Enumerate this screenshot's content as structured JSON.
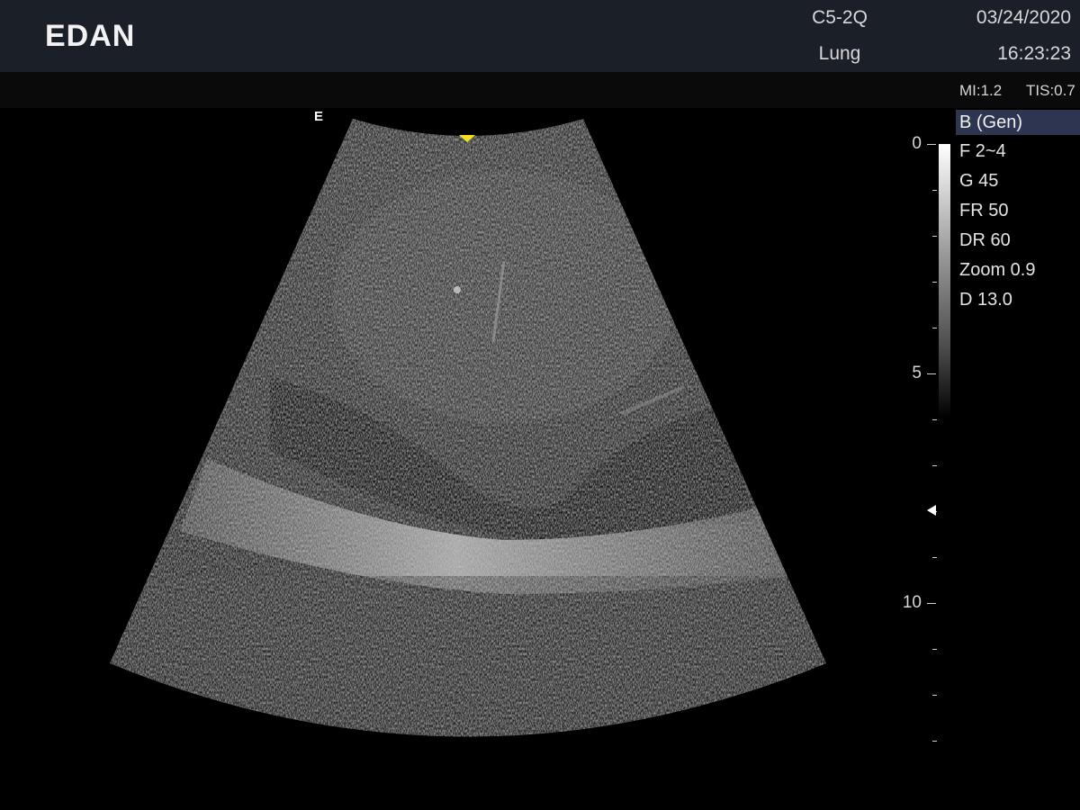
{
  "header": {
    "brand": "EDAN",
    "probe": "C5-2Q",
    "preset": "Lung",
    "date": "03/24/2020",
    "time": "16:23:23"
  },
  "safety": {
    "mi": "MI:1.2",
    "tis": "TIS:0.7"
  },
  "orientation_marker": "E",
  "depth_scale": {
    "labels": [
      "0",
      "5",
      "10"
    ],
    "unit_max": 13.0
  },
  "parameters": [
    {
      "label": "B (Gen)",
      "active": true
    },
    {
      "label": "F 2~4",
      "active": false
    },
    {
      "label": "G 45",
      "active": false
    },
    {
      "label": "FR 50",
      "active": false
    },
    {
      "label": "DR 60",
      "active": false
    },
    {
      "label": "Zoom 0.9",
      "active": false
    },
    {
      "label": "D 13.0",
      "active": false
    }
  ],
  "colors": {
    "header_bg": "#1b1f28",
    "active_param_bg": "#2d3550",
    "top_marker": "#f0e020"
  }
}
